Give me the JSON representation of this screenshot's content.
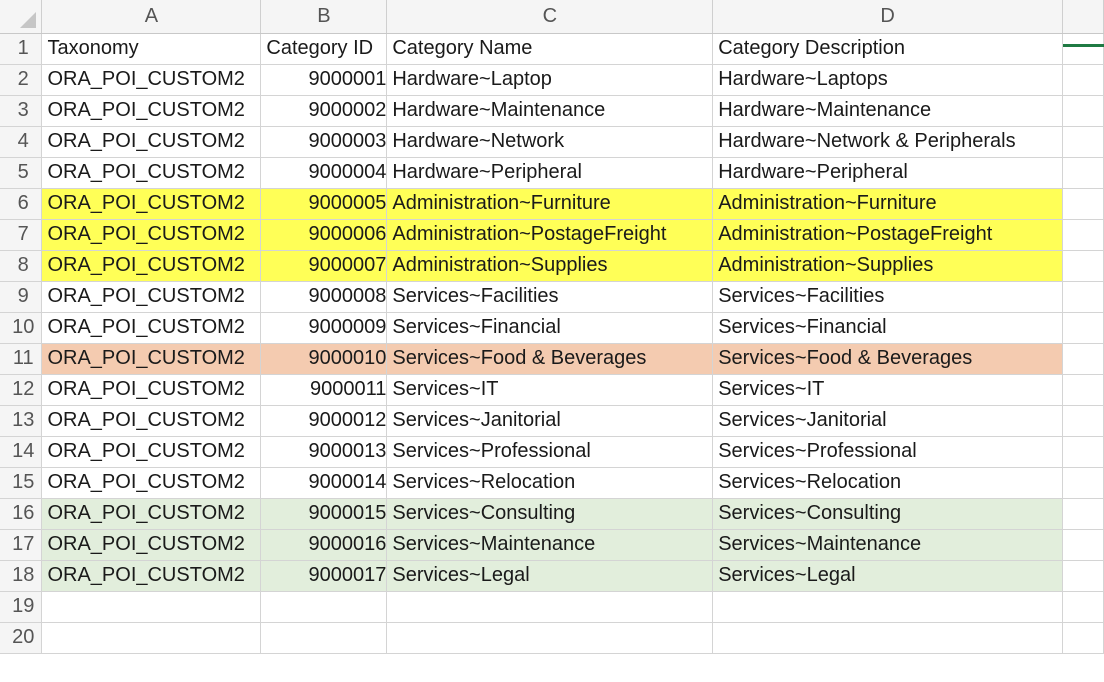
{
  "columns": [
    "A",
    "B",
    "C",
    "D"
  ],
  "rows": [
    {
      "num": "1",
      "cells": [
        "Taxonomy",
        "Category ID",
        "Category Name",
        "Category Description"
      ],
      "highlight": "none"
    },
    {
      "num": "2",
      "cells": [
        "ORA_POI_CUSTOM2",
        "9000001",
        "Hardware~Laptop",
        "Hardware~Laptops"
      ],
      "highlight": "none"
    },
    {
      "num": "3",
      "cells": [
        "ORA_POI_CUSTOM2",
        "9000002",
        "Hardware~Maintenance",
        "Hardware~Maintenance"
      ],
      "highlight": "none"
    },
    {
      "num": "4",
      "cells": [
        "ORA_POI_CUSTOM2",
        "9000003",
        "Hardware~Network",
        "Hardware~Network & Peripherals"
      ],
      "highlight": "none"
    },
    {
      "num": "5",
      "cells": [
        "ORA_POI_CUSTOM2",
        "9000004",
        "Hardware~Peripheral",
        "Hardware~Peripheral"
      ],
      "highlight": "none"
    },
    {
      "num": "6",
      "cells": [
        "ORA_POI_CUSTOM2",
        "9000005",
        "Administration~Furniture",
        "Administration~Furniture"
      ],
      "highlight": "yellow"
    },
    {
      "num": "7",
      "cells": [
        "ORA_POI_CUSTOM2",
        "9000006",
        "Administration~PostageFreight",
        "Administration~PostageFreight"
      ],
      "highlight": "yellow"
    },
    {
      "num": "8",
      "cells": [
        "ORA_POI_CUSTOM2",
        "9000007",
        "Administration~Supplies",
        "Administration~Supplies"
      ],
      "highlight": "yellow"
    },
    {
      "num": "9",
      "cells": [
        "ORA_POI_CUSTOM2",
        "9000008",
        "Services~Facilities",
        "Services~Facilities"
      ],
      "highlight": "none"
    },
    {
      "num": "10",
      "cells": [
        "ORA_POI_CUSTOM2",
        "9000009",
        "Services~Financial",
        "Services~Financial"
      ],
      "highlight": "none"
    },
    {
      "num": "11",
      "cells": [
        "ORA_POI_CUSTOM2",
        "9000010",
        "Services~Food & Beverages",
        "Services~Food & Beverages"
      ],
      "highlight": "peach"
    },
    {
      "num": "12",
      "cells": [
        "ORA_POI_CUSTOM2",
        "9000011",
        "Services~IT",
        "Services~IT"
      ],
      "highlight": "none"
    },
    {
      "num": "13",
      "cells": [
        "ORA_POI_CUSTOM2",
        "9000012",
        "Services~Janitorial",
        "Services~Janitorial"
      ],
      "highlight": "none"
    },
    {
      "num": "14",
      "cells": [
        "ORA_POI_CUSTOM2",
        "9000013",
        "Services~Professional",
        "Services~Professional"
      ],
      "highlight": "none"
    },
    {
      "num": "15",
      "cells": [
        "ORA_POI_CUSTOM2",
        "9000014",
        "Services~Relocation",
        "Services~Relocation"
      ],
      "highlight": "none"
    },
    {
      "num": "16",
      "cells": [
        "ORA_POI_CUSTOM2",
        "9000015",
        "Services~Consulting",
        "Services~Consulting"
      ],
      "highlight": "green"
    },
    {
      "num": "17",
      "cells": [
        "ORA_POI_CUSTOM2",
        "9000016",
        "Services~Maintenance",
        "Services~Maintenance"
      ],
      "highlight": "green"
    },
    {
      "num": "18",
      "cells": [
        "ORA_POI_CUSTOM2",
        "9000017",
        "Services~Legal",
        "Services~Legal"
      ],
      "highlight": "green"
    },
    {
      "num": "19",
      "cells": [
        "",
        "",
        "",
        ""
      ],
      "highlight": "none"
    },
    {
      "num": "20",
      "cells": [
        "",
        "",
        "",
        ""
      ],
      "highlight": "none"
    }
  ],
  "colors": {
    "yellow": "#ffff57",
    "peach": "#f4cbb0",
    "green": "#e2eedc",
    "header_bg": "#f5f5f5",
    "accent": "#1f7a43"
  }
}
